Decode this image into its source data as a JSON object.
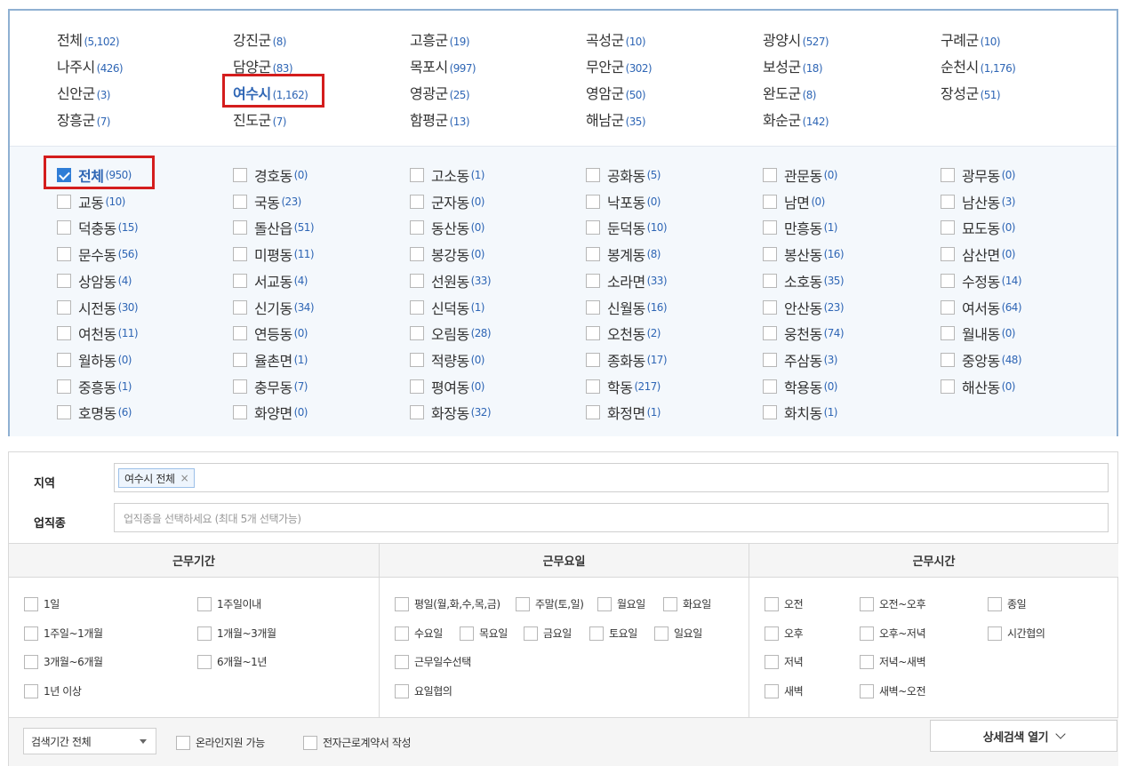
{
  "cities": [
    {
      "name": "전체",
      "count": "(5,102)"
    },
    {
      "name": "강진군",
      "count": "(8)"
    },
    {
      "name": "고흥군",
      "count": "(19)"
    },
    {
      "name": "곡성군",
      "count": "(10)"
    },
    {
      "name": "광양시",
      "count": "(527)"
    },
    {
      "name": "구례군",
      "count": "(10)"
    },
    {
      "name": "나주시",
      "count": "(426)"
    },
    {
      "name": "담양군",
      "count": "(83)"
    },
    {
      "name": "목포시",
      "count": "(997)"
    },
    {
      "name": "무안군",
      "count": "(302)"
    },
    {
      "name": "보성군",
      "count": "(18)"
    },
    {
      "name": "순천시",
      "count": "(1,176)"
    },
    {
      "name": "신안군",
      "count": "(3)"
    },
    {
      "name": "여수시",
      "count": "(1,162)",
      "selected": true
    },
    {
      "name": "영광군",
      "count": "(25)"
    },
    {
      "name": "영암군",
      "count": "(50)"
    },
    {
      "name": "완도군",
      "count": "(8)"
    },
    {
      "name": "장성군",
      "count": "(51)"
    },
    {
      "name": "장흥군",
      "count": "(7)"
    },
    {
      "name": "진도군",
      "count": "(7)"
    },
    {
      "name": "함평군",
      "count": "(13)"
    },
    {
      "name": "해남군",
      "count": "(35)"
    },
    {
      "name": "화순군",
      "count": "(142)"
    }
  ],
  "dongs": [
    {
      "name": "전체",
      "count": "(950)",
      "checked": true
    },
    {
      "name": "경호동",
      "count": "(0)"
    },
    {
      "name": "고소동",
      "count": "(1)"
    },
    {
      "name": "공화동",
      "count": "(5)"
    },
    {
      "name": "관문동",
      "count": "(0)"
    },
    {
      "name": "광무동",
      "count": "(0)"
    },
    {
      "name": "교동",
      "count": "(10)"
    },
    {
      "name": "국동",
      "count": "(23)"
    },
    {
      "name": "군자동",
      "count": "(0)"
    },
    {
      "name": "낙포동",
      "count": "(0)"
    },
    {
      "name": "남면",
      "count": "(0)"
    },
    {
      "name": "남산동",
      "count": "(3)"
    },
    {
      "name": "덕충동",
      "count": "(15)"
    },
    {
      "name": "돌산읍",
      "count": "(51)"
    },
    {
      "name": "동산동",
      "count": "(0)"
    },
    {
      "name": "둔덕동",
      "count": "(10)"
    },
    {
      "name": "만흥동",
      "count": "(1)"
    },
    {
      "name": "묘도동",
      "count": "(0)"
    },
    {
      "name": "문수동",
      "count": "(56)"
    },
    {
      "name": "미평동",
      "count": "(11)"
    },
    {
      "name": "봉강동",
      "count": "(0)"
    },
    {
      "name": "봉계동",
      "count": "(8)"
    },
    {
      "name": "봉산동",
      "count": "(16)"
    },
    {
      "name": "삼산면",
      "count": "(0)"
    },
    {
      "name": "상암동",
      "count": "(4)"
    },
    {
      "name": "서교동",
      "count": "(4)"
    },
    {
      "name": "선원동",
      "count": "(33)"
    },
    {
      "name": "소라면",
      "count": "(33)"
    },
    {
      "name": "소호동",
      "count": "(35)"
    },
    {
      "name": "수정동",
      "count": "(14)"
    },
    {
      "name": "시전동",
      "count": "(30)"
    },
    {
      "name": "신기동",
      "count": "(34)"
    },
    {
      "name": "신덕동",
      "count": "(1)"
    },
    {
      "name": "신월동",
      "count": "(16)"
    },
    {
      "name": "안산동",
      "count": "(23)"
    },
    {
      "name": "여서동",
      "count": "(64)"
    },
    {
      "name": "여천동",
      "count": "(11)"
    },
    {
      "name": "연등동",
      "count": "(0)"
    },
    {
      "name": "오림동",
      "count": "(28)"
    },
    {
      "name": "오천동",
      "count": "(2)"
    },
    {
      "name": "웅천동",
      "count": "(74)"
    },
    {
      "name": "월내동",
      "count": "(0)"
    },
    {
      "name": "월하동",
      "count": "(0)"
    },
    {
      "name": "율촌면",
      "count": "(1)"
    },
    {
      "name": "적량동",
      "count": "(0)"
    },
    {
      "name": "종화동",
      "count": "(17)"
    },
    {
      "name": "주삼동",
      "count": "(3)"
    },
    {
      "name": "중앙동",
      "count": "(48)"
    },
    {
      "name": "중흥동",
      "count": "(1)"
    },
    {
      "name": "충무동",
      "count": "(7)"
    },
    {
      "name": "평여동",
      "count": "(0)"
    },
    {
      "name": "학동",
      "count": "(217)"
    },
    {
      "name": "학용동",
      "count": "(0)"
    },
    {
      "name": "해산동",
      "count": "(0)"
    },
    {
      "name": "호명동",
      "count": "(6)"
    },
    {
      "name": "화양면",
      "count": "(0)"
    },
    {
      "name": "화장동",
      "count": "(32)"
    },
    {
      "name": "화정면",
      "count": "(1)"
    },
    {
      "name": "화치동",
      "count": "(1)"
    }
  ],
  "filters": {
    "region_label": "지역",
    "region_tag": "여수시 전체",
    "region_tag_remove": "×",
    "job_label": "업직종",
    "job_placeholder": "업직종을 선택하세요 (최대 5개 선택가능)"
  },
  "work": {
    "period": {
      "title": "근무기간",
      "options": [
        "1일",
        "1주일이내",
        "1주일~1개월",
        "1개월~3개월",
        "3개월~6개월",
        "6개월~1년",
        "1년 이상"
      ]
    },
    "days": {
      "title": "근무요일",
      "options": [
        "평일(월,화,수,목,금)",
        "주말(토,일)",
        "월요일",
        "화요일",
        "수요일",
        "목요일",
        "금요일",
        "토요일",
        "일요일",
        "근무일수선택",
        "요일협의"
      ]
    },
    "hours": {
      "title": "근무시간",
      "options": [
        "오전",
        "오전~오후",
        "종일",
        "오후",
        "오후~저녁",
        "시간협의",
        "저녁",
        "저녁~새벽",
        "새벽",
        "새벽~오전"
      ]
    }
  },
  "bottom": {
    "period_select": "검색기간 전체",
    "online_support": "온라인지원 가능",
    "e_contract": "전자근로계약서 작성",
    "detail_search": "상세검색 열기"
  }
}
